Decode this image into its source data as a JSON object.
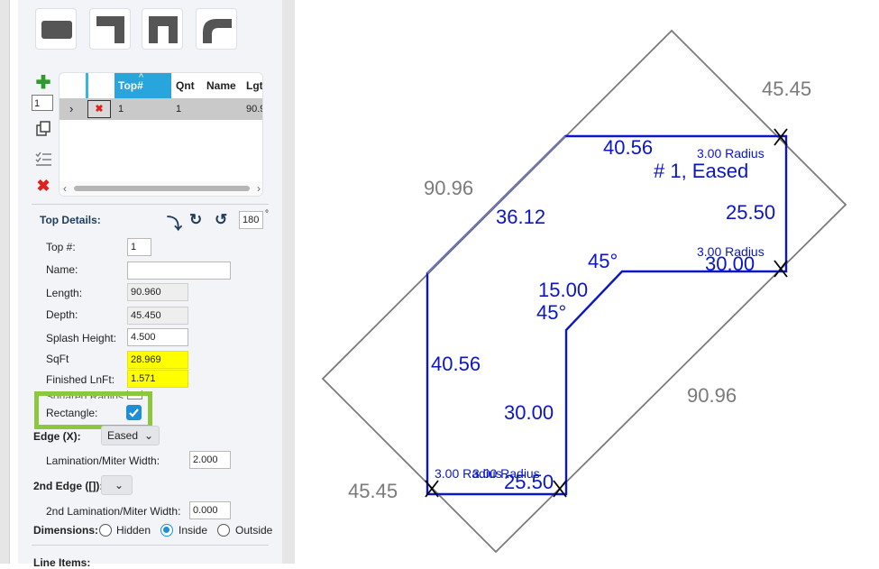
{
  "grid": {
    "headers": [
      "Top#",
      "Qnt",
      "Name",
      "Lgt"
    ],
    "row": {
      "top": "1",
      "qnt": "1",
      "lgt": "90.9"
    }
  },
  "qty_input": "1",
  "details": {
    "title": "Top Details:",
    "rotation_value": "180",
    "degree_symbol": "°",
    "top_label": "Top #:",
    "top_value": "1",
    "name_label": "Name:",
    "name_value": "",
    "length_label": "Length:",
    "length_value": "90.960",
    "depth_label": "Depth:",
    "depth_value": "45.450",
    "splash_label": "Splash Height:",
    "splash_value": "4.500",
    "sqft_label": "SqFt",
    "sqft_value": "28.969",
    "lnft_label": "Finished LnFt:",
    "lnft_value": "1.571",
    "squared_label": "Squared Radius:",
    "rectangle_label": "Rectangle:",
    "edge_label": "Edge (X):",
    "edge_value": "Eased",
    "lam_label": "Lamination/Miter Width:",
    "lam_value": "2.000",
    "edge2_label": "2nd Edge ([]):",
    "lam2_label": "2nd Lamination/Miter Width:",
    "lam2_value": "0.000",
    "dims_label": "Dimensions:",
    "dims_options": [
      "Hidden",
      "Inside",
      "Outside"
    ],
    "dims_selected": "Inside",
    "line_items_label": "Line Items:"
  },
  "canvas": {
    "outer_top": "45.45",
    "outer_left_top": "90.96",
    "outer_right_bottom": "90.96",
    "outer_bottom": "45.45",
    "top_edge": "40.56",
    "diag_edge": "36.12",
    "right_edge": "25.50",
    "inner_top": "30.00",
    "inner_diag": "15.00",
    "angle_upper": "45°",
    "angle_lower": "45°",
    "left_edge": "40.56",
    "inner_left": "30.00",
    "bottom_edge": "25.50",
    "top_label": "# 1, Eased",
    "radius_1": "3.00 Radius",
    "radius_2": "3.00 Radius",
    "radius_3": "3.00 Radius",
    "radius_4": "3.00 Radius"
  },
  "colors": {
    "accent": "#1c8fd6",
    "highlight_green": "#8dc63f",
    "shape_blue": "#0a16c8",
    "dim_gray": "#7a7a7a"
  }
}
